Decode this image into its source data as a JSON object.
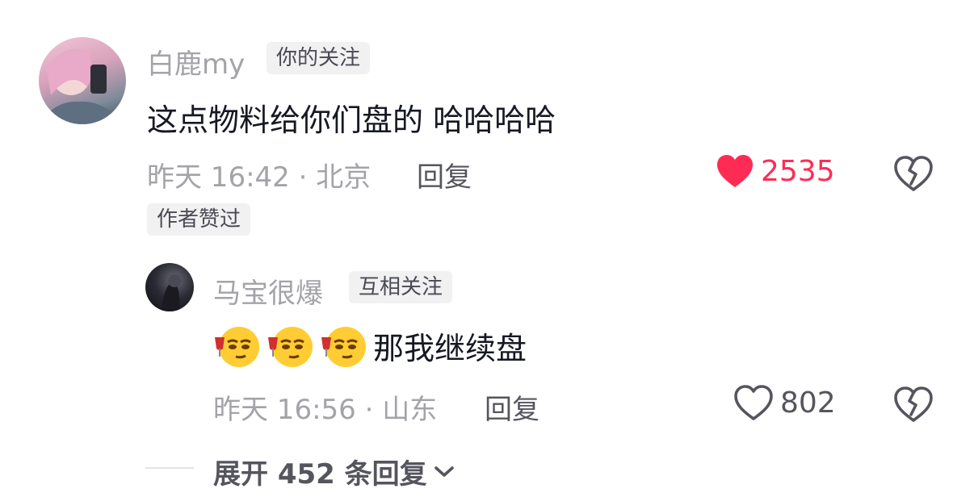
{
  "comment": {
    "author": "白鹿my",
    "relation_tag": "你的关注",
    "text": "这点物料给你们盘的 哈哈哈哈",
    "time_location": "昨天 16:42 · 北京",
    "reply_label": "回复",
    "like_count": "2535",
    "liked": true,
    "author_liked_badge": "作者赞过"
  },
  "reply": {
    "author": "马宝很爆",
    "relation_tag": "互相关注",
    "emoji_count": 3,
    "text": "那我继续盘",
    "time_location": "昨天 16:56 · 山东",
    "reply_label": "回复",
    "like_count": "802",
    "liked": false
  },
  "expand": {
    "label": "展开 452 条回复"
  },
  "colors": {
    "liked_red": "#fe2c55",
    "muted_gray": "#a3a3a8",
    "tag_bg": "#f1f1f2"
  },
  "icons": [
    "heart-filled-icon",
    "heart-outline-icon",
    "broken-heart-icon",
    "chevron-down-icon",
    "toast-emoji-icon"
  ]
}
